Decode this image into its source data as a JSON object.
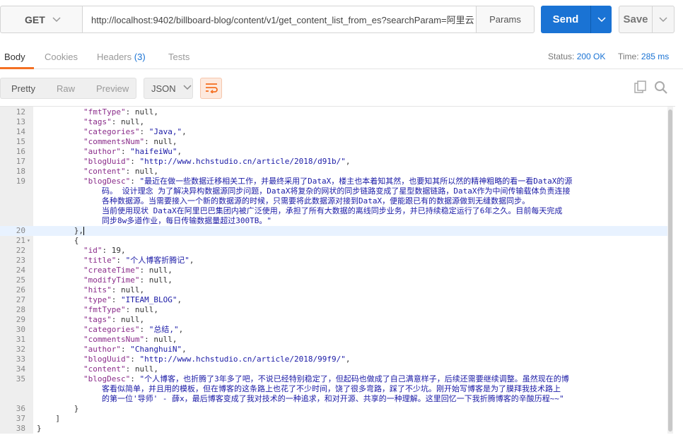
{
  "request": {
    "method": "GET",
    "url": "http://localhost:9402/billboard-blog/content/v1/get_content_list_from_es?searchParam=阿里云",
    "params_label": "Params",
    "send_label": "Send",
    "save_label": "Save"
  },
  "response": {
    "tabs": [
      {
        "label": "Body"
      },
      {
        "label": "Cookies"
      },
      {
        "label": "Headers",
        "count": "(3)"
      },
      {
        "label": "Tests"
      }
    ],
    "status_label": "Status:",
    "status_value": "200 OK",
    "time_label": "Time:",
    "time_value": "285 ms"
  },
  "toolbar": {
    "formats": [
      "Pretty",
      "Raw",
      "Preview"
    ],
    "selected_format": "Pretty",
    "language": "JSON"
  },
  "colors": {
    "accent": "#f47023",
    "primary": "#1a73d4",
    "json_key": "#8a2c8a",
    "json_string": "#1a1aa6"
  },
  "code_lines": [
    {
      "n": "12",
      "indent": 5,
      "key": "fmtType",
      "val": "null"
    },
    {
      "n": "13",
      "indent": 5,
      "key": "tags",
      "val": "null"
    },
    {
      "n": "14",
      "indent": 5,
      "key": "categories",
      "val": "\"Java,\"",
      "str": true
    },
    {
      "n": "15",
      "indent": 5,
      "key": "commentsNum",
      "val": "null"
    },
    {
      "n": "16",
      "indent": 5,
      "key": "author",
      "val": "\"haifeiWu\"",
      "str": true
    },
    {
      "n": "17",
      "indent": 5,
      "key": "blogUuid",
      "val": "\"http://www.hchstudio.cn/article/2018/d91b/\"",
      "str": true
    },
    {
      "n": "18",
      "indent": 5,
      "key": "content",
      "val": "null"
    },
    {
      "n": "19",
      "indent": 5,
      "key": "blogDesc",
      "val": "\"最近在做一些数据迁移相关工作，并最终采用了DataX，楼主也本着知其然，也要知其所以然的精神粗略的看一看DataX的源",
      "str": true,
      "cont": [
        "码。 设计理念 为了解决异构数据源同步问题，DataX将复杂的网状的同步链路变成了星型数据链路，DataX作为中间传输载体负责连接",
        "各种数据源。当需要接入一个新的数据源的时候，只需要将此数据源对接到DataX，便能跟已有的数据源做到无缝数据同步。",
        "当前使用现状 DataX在阿里巴巴集团内被广泛使用，承担了所有大数据的离线同步业务，并已持续稳定运行了6年之久。目前每天完成",
        "同步8w多道作业，每日传输数据量超过300TB。\""
      ]
    },
    {
      "n": "20",
      "indent": 4,
      "raw": "},",
      "active": true
    },
    {
      "n": "21",
      "indent": 4,
      "raw": "{",
      "fold": true
    },
    {
      "n": "22",
      "indent": 5,
      "key": "id",
      "val": "19"
    },
    {
      "n": "23",
      "indent": 5,
      "key": "title",
      "val": "\"个人博客折腾记\"",
      "str": true
    },
    {
      "n": "24",
      "indent": 5,
      "key": "createTime",
      "val": "null"
    },
    {
      "n": "25",
      "indent": 5,
      "key": "modifyTime",
      "val": "null"
    },
    {
      "n": "26",
      "indent": 5,
      "key": "hits",
      "val": "null"
    },
    {
      "n": "27",
      "indent": 5,
      "key": "type",
      "val": "\"ITEAM_BLOG\"",
      "str": true
    },
    {
      "n": "28",
      "indent": 5,
      "key": "fmtType",
      "val": "null"
    },
    {
      "n": "29",
      "indent": 5,
      "key": "tags",
      "val": "null"
    },
    {
      "n": "30",
      "indent": 5,
      "key": "categories",
      "val": "\"总结,\"",
      "str": true
    },
    {
      "n": "31",
      "indent": 5,
      "key": "commentsNum",
      "val": "null"
    },
    {
      "n": "32",
      "indent": 5,
      "key": "author",
      "val": "\"ChanghuiN\"",
      "str": true
    },
    {
      "n": "33",
      "indent": 5,
      "key": "blogUuid",
      "val": "\"http://www.hchstudio.cn/article/2018/99f9/\"",
      "str": true
    },
    {
      "n": "34",
      "indent": 5,
      "key": "content",
      "val": "null"
    },
    {
      "n": "35",
      "indent": 5,
      "key": "blogDesc",
      "val": "\"个人博客，也折腾了3年多了吧，不说已经特别稳定了，但起码也做成了自己满意样子，后续还需要继续调整。虽然现在的博",
      "str": true,
      "cont": [
        "客看似简单，并且用的模板，但在博客的这条路上也花了不少时间，饶了很多弯路，踩了不少坑。刚开始写博客是为了膜拜我技术路上",
        "的第一位'导师' - 薛x，最后博客变成了我对技术的一种追求，和对开源、共享的一种理解。这里回忆一下我折腾博客的辛酸历程~~\""
      ]
    },
    {
      "n": "36",
      "indent": 4,
      "raw": "}"
    },
    {
      "n": "37",
      "indent": 2,
      "raw": "]"
    },
    {
      "n": "38",
      "indent": 0,
      "raw": "}"
    }
  ]
}
